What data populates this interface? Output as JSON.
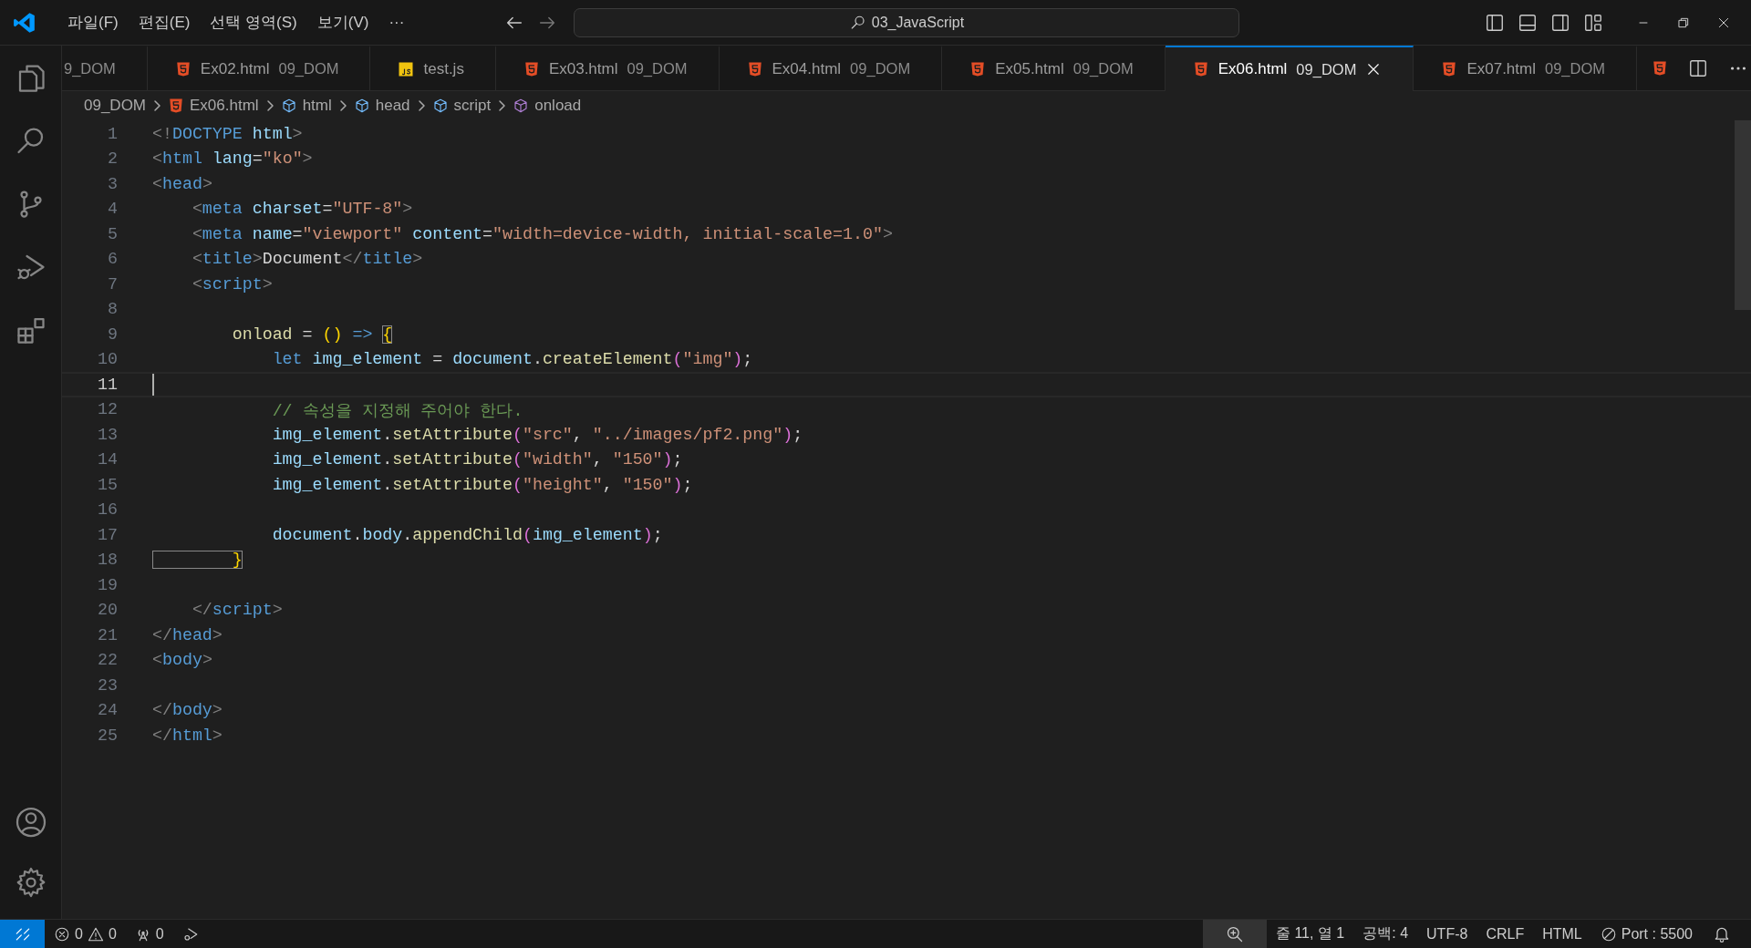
{
  "title_bar": {
    "menus": [
      "파일(F)",
      "편집(E)",
      "선택 영역(S)",
      "보기(V)",
      "···"
    ],
    "command_center": "03_JavaScript"
  },
  "tabs": [
    {
      "kind": "cut",
      "folder": "9_DOM",
      "selected": false
    },
    {
      "kind": "html",
      "name": "Ex02.html",
      "folder": "09_DOM",
      "selected": false
    },
    {
      "kind": "js",
      "name": "test.js",
      "selected": false
    },
    {
      "kind": "html",
      "name": "Ex03.html",
      "folder": "09_DOM",
      "selected": false
    },
    {
      "kind": "html",
      "name": "Ex04.html",
      "folder": "09_DOM",
      "selected": false
    },
    {
      "kind": "html",
      "name": "Ex05.html",
      "folder": "09_DOM",
      "selected": false
    },
    {
      "kind": "html",
      "name": "Ex06.html",
      "folder": "09_DOM",
      "selected": true
    },
    {
      "kind": "html",
      "name": "Ex07.html",
      "folder": "09_DOM",
      "selected": false
    }
  ],
  "breadcrumbs": [
    {
      "kind": "folder",
      "text": "09_DOM"
    },
    {
      "kind": "html",
      "text": "Ex06.html"
    },
    {
      "kind": "symbol",
      "text": "html"
    },
    {
      "kind": "symbol",
      "text": "head"
    },
    {
      "kind": "symbol",
      "text": "script"
    },
    {
      "kind": "method",
      "text": "onload"
    }
  ],
  "editor": {
    "lines": [
      {
        "number": "1",
        "current": false,
        "tokens": [
          {
            "kind": "p",
            "text": "<!"
          },
          {
            "kind": "tag",
            "text": "DOCTYPE "
          },
          {
            "kind": "attr",
            "text": "html"
          },
          {
            "kind": "p",
            "text": ">"
          }
        ]
      },
      {
        "number": "2",
        "current": false,
        "tokens": [
          {
            "kind": "p",
            "text": "<"
          },
          {
            "kind": "tag",
            "text": "html "
          },
          {
            "kind": "attr",
            "text": "lang"
          },
          {
            "kind": "txt",
            "text": "="
          },
          {
            "kind": "str",
            "text": "\"ko\""
          },
          {
            "kind": "p",
            "text": ">"
          }
        ]
      },
      {
        "number": "3",
        "current": false,
        "tokens": [
          {
            "kind": "p",
            "text": "<"
          },
          {
            "kind": "tag",
            "text": "head"
          },
          {
            "kind": "p",
            "text": ">"
          }
        ]
      },
      {
        "number": "4",
        "current": false,
        "tokens": [
          {
            "kind": "p",
            "text": "    <"
          },
          {
            "kind": "tag",
            "text": "meta "
          },
          {
            "kind": "attr",
            "text": "charset"
          },
          {
            "kind": "txt",
            "text": "="
          },
          {
            "kind": "str",
            "text": "\"UTF-8\""
          },
          {
            "kind": "p",
            "text": ">"
          }
        ]
      },
      {
        "number": "5",
        "current": false,
        "tokens": [
          {
            "kind": "p",
            "text": "    <"
          },
          {
            "kind": "tag",
            "text": "meta "
          },
          {
            "kind": "attr",
            "text": "name"
          },
          {
            "kind": "txt",
            "text": "="
          },
          {
            "kind": "str",
            "text": "\"viewport\" "
          },
          {
            "kind": "attr",
            "text": "content"
          },
          {
            "kind": "txt",
            "text": "="
          },
          {
            "kind": "str",
            "text": "\"width=device-width, initial-scale=1.0\""
          },
          {
            "kind": "p",
            "text": ">"
          }
        ]
      },
      {
        "number": "6",
        "current": false,
        "tokens": [
          {
            "kind": "p",
            "text": "    <"
          },
          {
            "kind": "tag",
            "text": "title"
          },
          {
            "kind": "p",
            "text": ">"
          },
          {
            "kind": "txt",
            "text": "Document"
          },
          {
            "kind": "p",
            "text": "</"
          },
          {
            "kind": "tag",
            "text": "title"
          },
          {
            "kind": "p",
            "text": ">"
          }
        ]
      },
      {
        "number": "7",
        "current": false,
        "tokens": [
          {
            "kind": "p",
            "text": "    <"
          },
          {
            "kind": "tag",
            "text": "script"
          },
          {
            "kind": "p",
            "text": ">"
          }
        ]
      },
      {
        "number": "8",
        "current": false
      },
      {
        "number": "9",
        "current": false,
        "tokens": [
          {
            "kind": "fn",
            "text": "        onload"
          },
          {
            "kind": "txt",
            "text": " = "
          },
          {
            "kind": "b1",
            "text": "()"
          },
          {
            "kind": "kw",
            "text": " => "
          },
          {
            "kind": "match",
            "text": "{"
          }
        ]
      },
      {
        "number": "10",
        "current": false,
        "tokens": [
          {
            "kind": "kw",
            "text": "            let "
          },
          {
            "kind": "var",
            "text": "img_element"
          },
          {
            "kind": "txt",
            "text": " = "
          },
          {
            "kind": "var",
            "text": "document"
          },
          {
            "kind": "txt",
            "text": "."
          },
          {
            "kind": "fn",
            "text": "createElement"
          },
          {
            "kind": "b2",
            "text": "("
          },
          {
            "kind": "str",
            "text": "\"img\""
          },
          {
            "kind": "b2",
            "text": ")"
          },
          {
            "kind": "txt",
            "text": ";"
          }
        ]
      },
      {
        "number": "11",
        "current": true
      },
      {
        "number": "12",
        "current": false,
        "tokens": [
          {
            "kind": "cmt",
            "text": "            // 속성을 지정해 주어야 한다."
          }
        ]
      },
      {
        "number": "13",
        "current": false,
        "tokens": [
          {
            "kind": "var",
            "text": "            img_element"
          },
          {
            "kind": "txt",
            "text": "."
          },
          {
            "kind": "fn",
            "text": "setAttribute"
          },
          {
            "kind": "b2",
            "text": "("
          },
          {
            "kind": "str",
            "text": "\"src\""
          },
          {
            "kind": "txt",
            "text": ", "
          },
          {
            "kind": "str",
            "text": "\"../images/pf2.png\""
          },
          {
            "kind": "b2",
            "text": ")"
          },
          {
            "kind": "txt",
            "text": ";"
          }
        ]
      },
      {
        "number": "14",
        "current": false,
        "tokens": [
          {
            "kind": "var",
            "text": "            img_element"
          },
          {
            "kind": "txt",
            "text": "."
          },
          {
            "kind": "fn",
            "text": "setAttribute"
          },
          {
            "kind": "b2",
            "text": "("
          },
          {
            "kind": "str",
            "text": "\"width\""
          },
          {
            "kind": "txt",
            "text": ", "
          },
          {
            "kind": "str",
            "text": "\"150\""
          },
          {
            "kind": "b2",
            "text": ")"
          },
          {
            "kind": "txt",
            "text": ";"
          }
        ]
      },
      {
        "number": "15",
        "current": false,
        "tokens": [
          {
            "kind": "var",
            "text": "            img_element"
          },
          {
            "kind": "txt",
            "text": "."
          },
          {
            "kind": "fn",
            "text": "setAttribute"
          },
          {
            "kind": "b2",
            "text": "("
          },
          {
            "kind": "str",
            "text": "\"height\""
          },
          {
            "kind": "txt",
            "text": ", "
          },
          {
            "kind": "str",
            "text": "\"150\""
          },
          {
            "kind": "b2",
            "text": ")"
          },
          {
            "kind": "txt",
            "text": ";"
          }
        ]
      },
      {
        "number": "16",
        "current": false
      },
      {
        "number": "17",
        "current": false,
        "tokens": [
          {
            "kind": "var",
            "text": "            document"
          },
          {
            "kind": "txt",
            "text": "."
          },
          {
            "kind": "var",
            "text": "body"
          },
          {
            "kind": "txt",
            "text": "."
          },
          {
            "kind": "fn",
            "text": "appendChild"
          },
          {
            "kind": "b2",
            "text": "("
          },
          {
            "kind": "var",
            "text": "img_element"
          },
          {
            "kind": "b2",
            "text": ")"
          },
          {
            "kind": "txt",
            "text": ";"
          }
        ]
      },
      {
        "number": "18",
        "current": false,
        "tokens": [
          {
            "kind": "match",
            "text": "        }"
          }
        ]
      },
      {
        "number": "19",
        "current": false
      },
      {
        "number": "20",
        "current": false,
        "tokens": [
          {
            "kind": "p",
            "text": "    </"
          },
          {
            "kind": "tag",
            "text": "script"
          },
          {
            "kind": "p",
            "text": ">"
          }
        ]
      },
      {
        "number": "21",
        "current": false,
        "tokens": [
          {
            "kind": "p",
            "text": "</"
          },
          {
            "kind": "tag",
            "text": "head"
          },
          {
            "kind": "p",
            "text": ">"
          }
        ]
      },
      {
        "number": "22",
        "current": false,
        "tokens": [
          {
            "kind": "p",
            "text": "<"
          },
          {
            "kind": "tag",
            "text": "body"
          },
          {
            "kind": "p",
            "text": ">"
          }
        ]
      },
      {
        "number": "23",
        "current": false
      },
      {
        "number": "24",
        "current": false,
        "tokens": [
          {
            "kind": "p",
            "text": "</"
          },
          {
            "kind": "tag",
            "text": "body"
          },
          {
            "kind": "p",
            "text": ">"
          }
        ]
      },
      {
        "number": "25",
        "current": false,
        "tokens": [
          {
            "kind": "p",
            "text": "</"
          },
          {
            "kind": "tag",
            "text": "html"
          },
          {
            "kind": "p",
            "text": ">"
          }
        ]
      }
    ]
  },
  "status_bar": {
    "errors": "0",
    "warnings": "0",
    "ports": "0",
    "position": "줄 11, 열 1",
    "spaces": "공백: 4",
    "encoding": "UTF-8",
    "eol": "CRLF",
    "language": "HTML",
    "live_server": "Port : 5500"
  }
}
